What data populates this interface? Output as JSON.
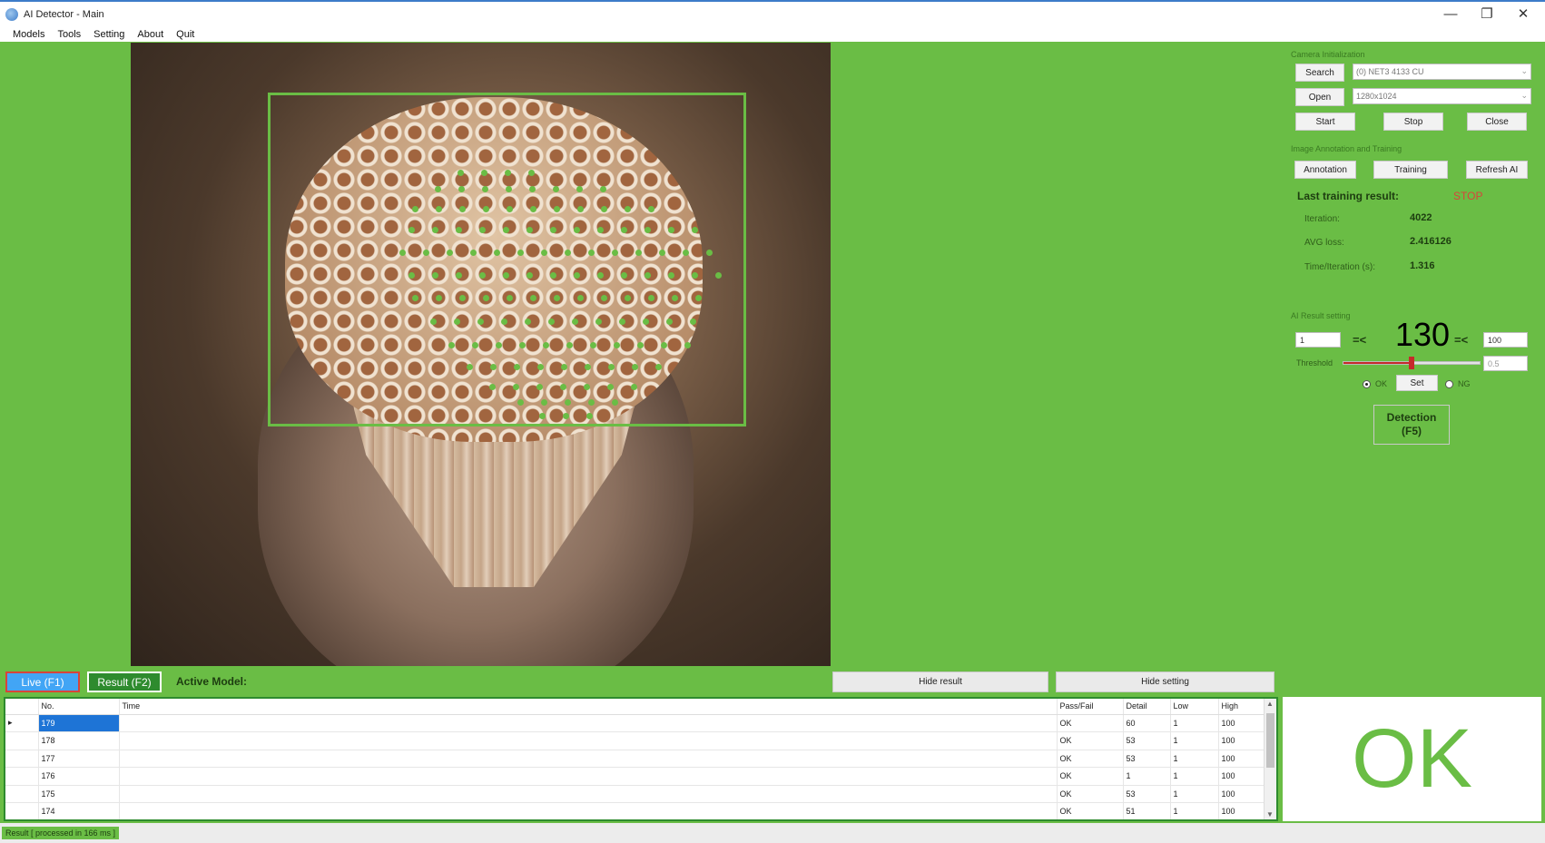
{
  "window": {
    "title": "AI Detector - Main",
    "minimize": "—",
    "restore": "❐",
    "close": "✕"
  },
  "menu": [
    "Models",
    "Tools",
    "Setting",
    "About",
    "Quit"
  ],
  "camera": {
    "group_label": "Camera Initialization",
    "search_label": "Search",
    "device": "(0) NET3 4133 CU",
    "open_label": "Open",
    "resolution": "1280x1024",
    "start_label": "Start",
    "stop_label": "Stop",
    "close_label": "Close"
  },
  "training": {
    "group_label": "Image Annotation and Training",
    "annotation_label": "Annotation",
    "training_label": "Training",
    "refresh_label": "Refresh AI",
    "last_result_label": "Last training result:",
    "status": "STOP",
    "iteration_label": "Iteration:",
    "iteration": "4022",
    "avg_loss_label": "AVG loss:",
    "avg_loss": "2.416126",
    "time_label": "Time/Iteration (s):",
    "time": "1.316"
  },
  "result_setting": {
    "group_label": "AI Result setting",
    "low": "1",
    "op1": "=<",
    "count": "130",
    "op2": "=<",
    "high": "100",
    "threshold_label": "Threshold",
    "threshold": "0.5",
    "threshold_level": 0.5,
    "ok_label": "OK",
    "set_label": "Set",
    "ng_label": "NG",
    "selected": "OK"
  },
  "detection_button": {
    "line1": "Detection",
    "line2": "(F5)"
  },
  "bottom": {
    "live_label": "Live (F1)",
    "result_label": "Result (F2)",
    "active_model_label": "Active Model:",
    "hide_result_label": "Hide result",
    "hide_setting_label": "Hide setting"
  },
  "table": {
    "columns": [
      "No.",
      "Time",
      "Pass/Fail",
      "Detail",
      "Low",
      "High"
    ],
    "rows": [
      {
        "no": "179",
        "time": "",
        "pass": "OK",
        "detail": "60",
        "low": "1",
        "high": "100"
      },
      {
        "no": "178",
        "time": "",
        "pass": "OK",
        "detail": "53",
        "low": "1",
        "high": "100"
      },
      {
        "no": "177",
        "time": "",
        "pass": "OK",
        "detail": "53",
        "low": "1",
        "high": "100"
      },
      {
        "no": "176",
        "time": "",
        "pass": "OK",
        "detail": "1",
        "low": "1",
        "high": "100"
      },
      {
        "no": "175",
        "time": "",
        "pass": "OK",
        "detail": "53",
        "low": "1",
        "high": "100"
      },
      {
        "no": "174",
        "time": "",
        "pass": "OK",
        "detail": "51",
        "low": "1",
        "high": "100"
      }
    ]
  },
  "result_display": "OK",
  "status": "Result [ processed in 166 ms ]",
  "colors": {
    "accent": "#6abd45",
    "selection": "#1e74d6",
    "stop": "#d8443a"
  }
}
